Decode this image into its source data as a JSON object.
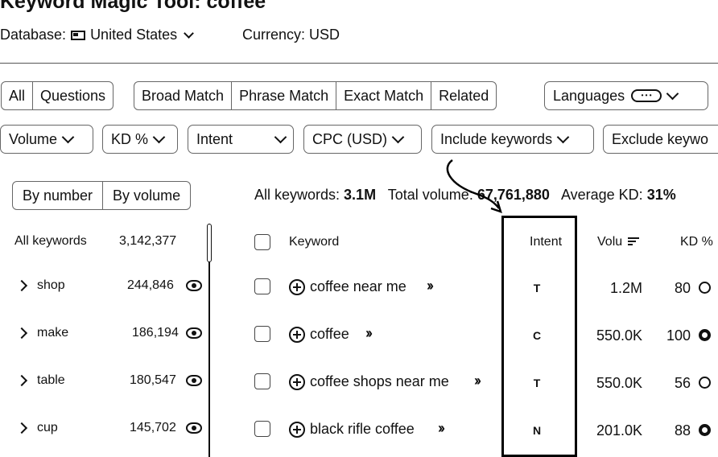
{
  "page_title": "Keyword Magic Tool: coffee",
  "database": {
    "label": "Database:",
    "value": "United States"
  },
  "currency": {
    "label": "Currency: USD"
  },
  "match_tabs": [
    "All",
    "Questions"
  ],
  "match_types": [
    "Broad Match",
    "Phrase Match",
    "Exact Match",
    "Related"
  ],
  "languages": {
    "label": "Languages",
    "icon": "language-badge-icon"
  },
  "filters": [
    "Volume",
    "KD %",
    "Intent",
    "CPC (USD)",
    "Include keywords",
    "Exclude keywo"
  ],
  "group_toggle": [
    "By number",
    "By volume"
  ],
  "stats": {
    "all_keywords_label": "All keywords:",
    "all_keywords_value": "3.1M",
    "total_volume_label": "Total volume:",
    "total_volume_value": "67,761,880",
    "avg_kd_label": "Average KD:",
    "avg_kd_value": "31%"
  },
  "sidebar": {
    "all_label": "All keywords",
    "all_count": "3,142,377",
    "groups": [
      {
        "label": "shop",
        "count": "244,846"
      },
      {
        "label": "make",
        "count": "186,194"
      },
      {
        "label": "table",
        "count": "180,547"
      },
      {
        "label": "cup",
        "count": "145,702"
      }
    ]
  },
  "table": {
    "headers": {
      "keyword": "Keyword",
      "intent": "Intent",
      "volume": "Volu",
      "kd": "KD %"
    },
    "rows": [
      {
        "keyword": "coffee near me",
        "intent": "T",
        "volume": "1.2M",
        "kd": "80"
      },
      {
        "keyword": "coffee",
        "intent": "C",
        "volume": "550.0K",
        "kd": "100"
      },
      {
        "keyword": "coffee shops near me",
        "intent": "T",
        "volume": "550.0K",
        "kd": "56"
      },
      {
        "keyword": "black rifle coffee",
        "intent": "N",
        "volume": "201.0K",
        "kd": "88"
      }
    ]
  },
  "colors": {
    "text": "#111111",
    "border": "#666666",
    "highlight": "#000000"
  }
}
